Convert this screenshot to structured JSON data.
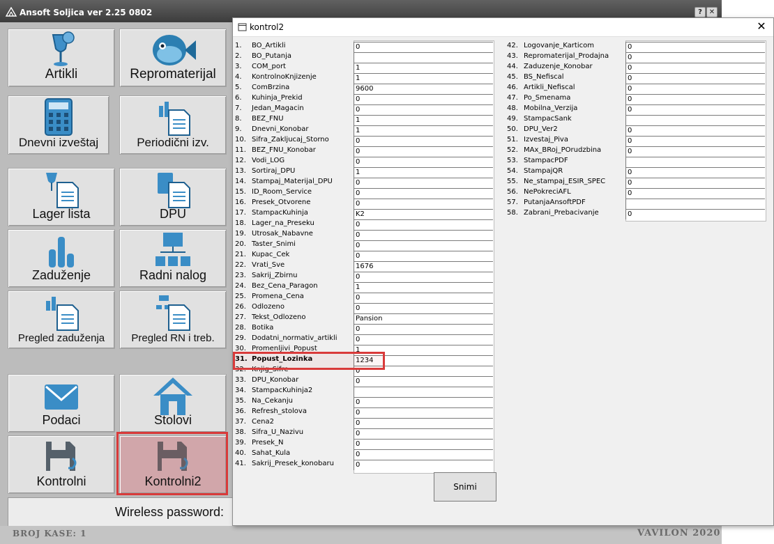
{
  "app": {
    "title": "Ansoft Soljica ver 2.25 0802",
    "help_btn": "?",
    "close_btn": "✕",
    "tiles": {
      "artikli": "Artikli",
      "repromaterijal": "Repromaterijal",
      "dnevni": "Dnevni izveštaj",
      "periodicni": "Periodični izv.",
      "lager": "Lager lista",
      "dpu": "DPU",
      "zaduzenje": "Zaduženje",
      "radni": "Radni nalog",
      "pregled_zad": "Pregled zaduženja",
      "pregled_rn": "Pregled RN i treb.",
      "podaci": "Podaci",
      "stolovi": "Stolovi",
      "kontrolni": "Kontrolni",
      "kontrolni2": "Kontrolni2"
    },
    "wireless_label": "Wireless password:",
    "footer_left": "BROJ KASE: 1",
    "footer_right": "VAVILON 2020"
  },
  "dialog": {
    "title": "kontrol2",
    "close": "✕",
    "save_button": "Snimi",
    "left_rows": [
      {
        "num": "1.",
        "name": "BO_Artikli",
        "value": "0"
      },
      {
        "num": "2.",
        "name": "BO_Putanja",
        "value": ""
      },
      {
        "num": "3.",
        "name": "COM_port",
        "value": "1"
      },
      {
        "num": "4.",
        "name": "KontrolnoKnjizenje",
        "value": "1"
      },
      {
        "num": "5.",
        "name": "ComBrzina",
        "value": "9600"
      },
      {
        "num": "6.",
        "name": "Kuhinja_Prekid",
        "value": "0"
      },
      {
        "num": "7.",
        "name": "Jedan_Magacin",
        "value": "0"
      },
      {
        "num": "8.",
        "name": "BEZ_FNU",
        "value": "1"
      },
      {
        "num": "9.",
        "name": "Dnevni_Konobar",
        "value": "1"
      },
      {
        "num": "10.",
        "name": "Sifra_Zakljucaj_Storno",
        "value": "0"
      },
      {
        "num": "11.",
        "name": "BEZ_FNU_Konobar",
        "value": "0"
      },
      {
        "num": "12.",
        "name": "Vodi_LOG",
        "value": "0"
      },
      {
        "num": "13.",
        "name": "Sortiraj_DPU",
        "value": "1"
      },
      {
        "num": "14.",
        "name": "Stampaj_Materijal_DPU",
        "value": "0"
      },
      {
        "num": "15.",
        "name": "ID_Room_Service",
        "value": "0"
      },
      {
        "num": "16.",
        "name": "Presek_Otvorene",
        "value": "0"
      },
      {
        "num": "17.",
        "name": "StampacKuhinja",
        "value": "K2"
      },
      {
        "num": "18.",
        "name": "Lager_na_Preseku",
        "value": "0"
      },
      {
        "num": "19.",
        "name": "Utrosak_Nabavne",
        "value": "0"
      },
      {
        "num": "20.",
        "name": "Taster_Snimi",
        "value": "0"
      },
      {
        "num": "21.",
        "name": "Kupac_Cek",
        "value": "0"
      },
      {
        "num": "22.",
        "name": "Vrati_Sve",
        "value": "1676"
      },
      {
        "num": "23.",
        "name": "Sakrij_Zbirnu",
        "value": "0"
      },
      {
        "num": "24.",
        "name": "Bez_Cena_Paragon",
        "value": "1"
      },
      {
        "num": "25.",
        "name": "Promena_Cena",
        "value": "0"
      },
      {
        "num": "26.",
        "name": "Odlozeno",
        "value": "0"
      },
      {
        "num": "27.",
        "name": "Tekst_Odlozeno",
        "value": "Pansion"
      },
      {
        "num": "28.",
        "name": "Botika",
        "value": "0"
      },
      {
        "num": "29.",
        "name": "Dodatni_normativ_artikli",
        "value": "0"
      },
      {
        "num": "30.",
        "name": "Promenljivi_Popust",
        "value": "1"
      },
      {
        "num": "31.",
        "name": "Popust_Lozinka",
        "value": "1234"
      },
      {
        "num": "32.",
        "name": "Knjig_Sifre",
        "value": "0"
      },
      {
        "num": "33.",
        "name": "DPU_Konobar",
        "value": "0"
      },
      {
        "num": "34.",
        "name": "StampacKuhinja2",
        "value": ""
      },
      {
        "num": "35.",
        "name": "Na_Cekanju",
        "value": "0"
      },
      {
        "num": "36.",
        "name": "Refresh_stolova",
        "value": "0"
      },
      {
        "num": "37.",
        "name": "Cena2",
        "value": "0"
      },
      {
        "num": "38.",
        "name": "Sifra_U_Nazivu",
        "value": "0"
      },
      {
        "num": "39.",
        "name": "Presek_N",
        "value": "0"
      },
      {
        "num": "40.",
        "name": "Sahat_Kula",
        "value": "0"
      },
      {
        "num": "41.",
        "name": "Sakrij_Presek_konobaru",
        "value": "0"
      }
    ],
    "right_rows": [
      {
        "num": "42.",
        "name": "Logovanje_Karticom",
        "value": "0"
      },
      {
        "num": "43.",
        "name": "Repromaterijal_Prodajna",
        "value": "0"
      },
      {
        "num": "44.",
        "name": "Zaduzenje_Konobar",
        "value": "0"
      },
      {
        "num": "45.",
        "name": "BS_Nefiscal",
        "value": "0"
      },
      {
        "num": "46.",
        "name": "Artikli_Nefiscal",
        "value": "0"
      },
      {
        "num": "47.",
        "name": "Po_Smenama",
        "value": "0"
      },
      {
        "num": "48.",
        "name": "Mobilna_Verzija",
        "value": "0"
      },
      {
        "num": "49.",
        "name": "StampacSank",
        "value": ""
      },
      {
        "num": "50.",
        "name": "DPU_Ver2",
        "value": "0"
      },
      {
        "num": "51.",
        "name": "Izvestaj_Piva",
        "value": "0"
      },
      {
        "num": "52.",
        "name": "MAx_BRoj_POrudzbina",
        "value": "0"
      },
      {
        "num": "53.",
        "name": "StampacPDF",
        "value": ""
      },
      {
        "num": "54.",
        "name": "StampajQR",
        "value": "0"
      },
      {
        "num": "55.",
        "name": "Ne_stampaj_ESIR_SPEC",
        "value": "0"
      },
      {
        "num": "56.",
        "name": "NePokreciAFL",
        "value": "0"
      },
      {
        "num": "57.",
        "name": "PutanjaAnsoftPDF",
        "value": ""
      },
      {
        "num": "58.",
        "name": "Zabrani_Prebacivanje",
        "value": "0"
      }
    ]
  }
}
